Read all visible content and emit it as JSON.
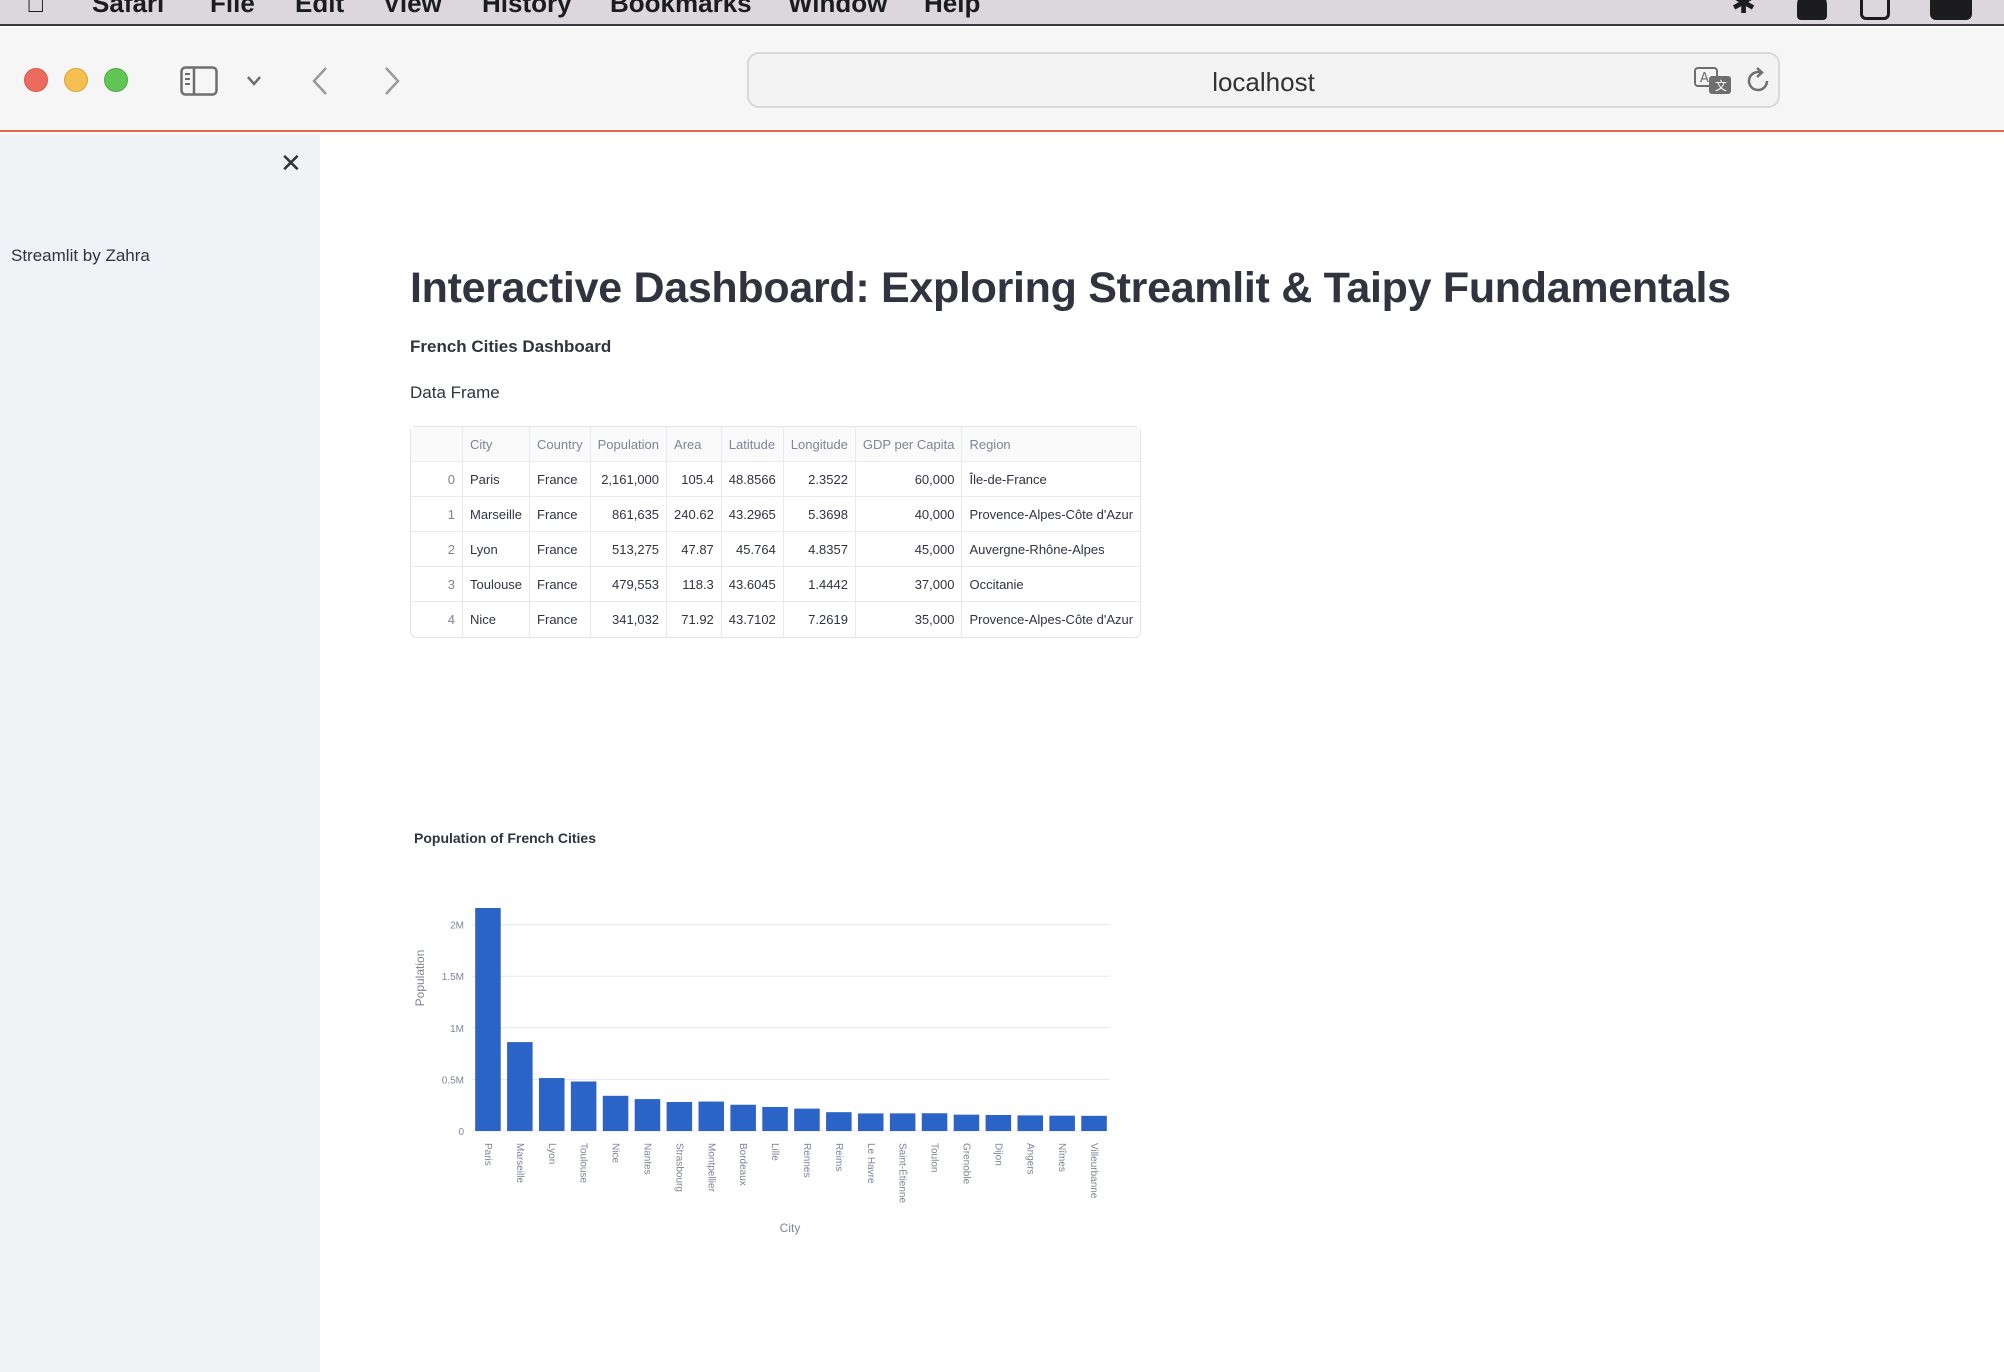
{
  "browser": {
    "menu": [
      "Safari",
      "File",
      "Edit",
      "View",
      "History",
      "Bookmarks",
      "Window",
      "Help"
    ],
    "url": "localhost"
  },
  "sidebar": {
    "text": "Streamlit by Zahra"
  },
  "main": {
    "title": "Interactive Dashboard: Exploring Streamlit & Taipy Fundamentals",
    "subtitle": "French Cities Dashboard",
    "dataframe_label": "Data Frame"
  },
  "table": {
    "columns": [
      "",
      "City",
      "Country",
      "Population",
      "Area",
      "Latitude",
      "Longitude",
      "GDP per Capita",
      "Region"
    ],
    "rows": [
      [
        "0",
        "Paris",
        "France",
        "2,161,000",
        "105.4",
        "48.8566",
        "2.3522",
        "60,000",
        "Île-de-France"
      ],
      [
        "1",
        "Marseille",
        "France",
        "861,635",
        "240.62",
        "43.2965",
        "5.3698",
        "40,000",
        "Provence-Alpes-Côte d'Azur"
      ],
      [
        "2",
        "Lyon",
        "France",
        "513,275",
        "47.87",
        "45.764",
        "4.8357",
        "45,000",
        "Auvergne-Rhône-Alpes"
      ],
      [
        "3",
        "Toulouse",
        "France",
        "479,553",
        "118.3",
        "43.6045",
        "1.4442",
        "37,000",
        "Occitanie"
      ],
      [
        "4",
        "Nice",
        "France",
        "341,032",
        "71.92",
        "43.7102",
        "7.2619",
        "35,000",
        "Provence-Alpes-Côte d'Azur"
      ]
    ]
  },
  "chart_data": {
    "type": "bar",
    "title": "Population of French Cities",
    "xlabel": "City",
    "ylabel": "Population",
    "categories": [
      "Paris",
      "Marseille",
      "Lyon",
      "Toulouse",
      "Nice",
      "Nantes",
      "Strasbourg",
      "Montpellier",
      "Bordeaux",
      "Lille",
      "Rennes",
      "Reims",
      "Le Havre",
      "Saint-Étienne",
      "Toulon",
      "Grenoble",
      "Dijon",
      "Angers",
      "Nîmes",
      "Villeurbanne"
    ],
    "values": [
      2161000,
      861635,
      513275,
      479553,
      341032,
      309346,
      280966,
      285121,
      254436,
      232741,
      216815,
      182460,
      170147,
      171057,
      171953,
      158454,
      155090,
      151229,
      148561,
      147192
    ],
    "ylim": [
      0,
      2161000
    ],
    "yticks": [
      0,
      500000,
      1000000,
      1500000,
      2000000
    ],
    "ytick_labels": [
      "0",
      "0.5M",
      "1M",
      "1.5M",
      "2M"
    ],
    "grid": true,
    "color": "#2c63c7"
  }
}
